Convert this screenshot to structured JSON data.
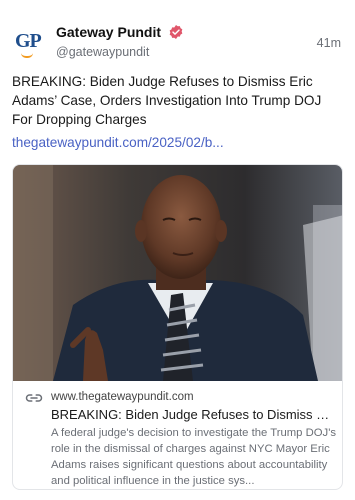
{
  "author": {
    "name": "Gateway Pundit",
    "handle": "@gatewaypundit",
    "avatar_letters": "GP",
    "time": "41m"
  },
  "post": {
    "text": "BREAKING: Biden Judge Refuses to Dismiss Eric Adams’ Case, Orders Investigation Into Trump DOJ For Dropping Charges",
    "link_text": "thegatewaypundit.com/2025/02/b..."
  },
  "card": {
    "domain": "www.thegatewaypundit.com",
    "title": "BREAKING: Biden Judge Refuses to Dismiss Eri...",
    "description": "A federal judge's decision to investigate the Trump DOJ's role in the dismissal of charges against NYC Mayor Eric Adams raises significant questions about accountability and political influence in the justice sys..."
  },
  "colors": {
    "link": "#4a62c4",
    "verified_badge": "#e0566a",
    "avatar_text": "#1f4e8c",
    "avatar_accent": "#f29b20"
  },
  "icons": [
    "verified-badge-icon",
    "link-icon"
  ]
}
